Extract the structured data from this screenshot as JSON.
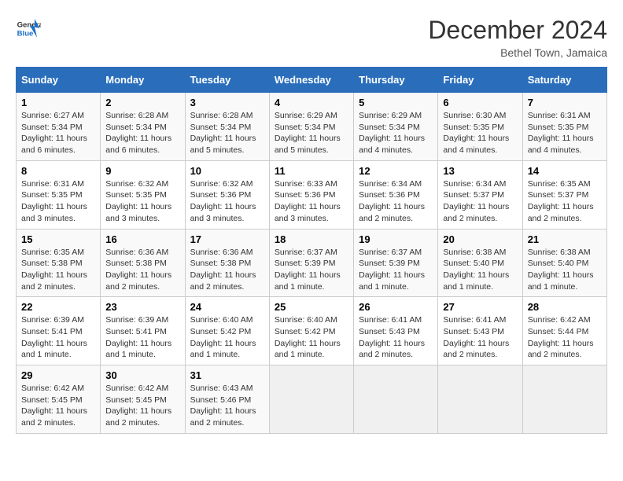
{
  "header": {
    "logo_general": "General",
    "logo_blue": "Blue",
    "month_title": "December 2024",
    "location": "Bethel Town, Jamaica"
  },
  "columns": [
    "Sunday",
    "Monday",
    "Tuesday",
    "Wednesday",
    "Thursday",
    "Friday",
    "Saturday"
  ],
  "weeks": [
    [
      {
        "day": "1",
        "sunrise": "6:27 AM",
        "sunset": "5:34 PM",
        "daylight": "11 hours and 6 minutes."
      },
      {
        "day": "2",
        "sunrise": "6:28 AM",
        "sunset": "5:34 PM",
        "daylight": "11 hours and 6 minutes."
      },
      {
        "day": "3",
        "sunrise": "6:28 AM",
        "sunset": "5:34 PM",
        "daylight": "11 hours and 5 minutes."
      },
      {
        "day": "4",
        "sunrise": "6:29 AM",
        "sunset": "5:34 PM",
        "daylight": "11 hours and 5 minutes."
      },
      {
        "day": "5",
        "sunrise": "6:29 AM",
        "sunset": "5:34 PM",
        "daylight": "11 hours and 4 minutes."
      },
      {
        "day": "6",
        "sunrise": "6:30 AM",
        "sunset": "5:35 PM",
        "daylight": "11 hours and 4 minutes."
      },
      {
        "day": "7",
        "sunrise": "6:31 AM",
        "sunset": "5:35 PM",
        "daylight": "11 hours and 4 minutes."
      }
    ],
    [
      {
        "day": "8",
        "sunrise": "6:31 AM",
        "sunset": "5:35 PM",
        "daylight": "11 hours and 3 minutes."
      },
      {
        "day": "9",
        "sunrise": "6:32 AM",
        "sunset": "5:35 PM",
        "daylight": "11 hours and 3 minutes."
      },
      {
        "day": "10",
        "sunrise": "6:32 AM",
        "sunset": "5:36 PM",
        "daylight": "11 hours and 3 minutes."
      },
      {
        "day": "11",
        "sunrise": "6:33 AM",
        "sunset": "5:36 PM",
        "daylight": "11 hours and 3 minutes."
      },
      {
        "day": "12",
        "sunrise": "6:34 AM",
        "sunset": "5:36 PM",
        "daylight": "11 hours and 2 minutes."
      },
      {
        "day": "13",
        "sunrise": "6:34 AM",
        "sunset": "5:37 PM",
        "daylight": "11 hours and 2 minutes."
      },
      {
        "day": "14",
        "sunrise": "6:35 AM",
        "sunset": "5:37 PM",
        "daylight": "11 hours and 2 minutes."
      }
    ],
    [
      {
        "day": "15",
        "sunrise": "6:35 AM",
        "sunset": "5:38 PM",
        "daylight": "11 hours and 2 minutes."
      },
      {
        "day": "16",
        "sunrise": "6:36 AM",
        "sunset": "5:38 PM",
        "daylight": "11 hours and 2 minutes."
      },
      {
        "day": "17",
        "sunrise": "6:36 AM",
        "sunset": "5:38 PM",
        "daylight": "11 hours and 2 minutes."
      },
      {
        "day": "18",
        "sunrise": "6:37 AM",
        "sunset": "5:39 PM",
        "daylight": "11 hours and 1 minute."
      },
      {
        "day": "19",
        "sunrise": "6:37 AM",
        "sunset": "5:39 PM",
        "daylight": "11 hours and 1 minute."
      },
      {
        "day": "20",
        "sunrise": "6:38 AM",
        "sunset": "5:40 PM",
        "daylight": "11 hours and 1 minute."
      },
      {
        "day": "21",
        "sunrise": "6:38 AM",
        "sunset": "5:40 PM",
        "daylight": "11 hours and 1 minute."
      }
    ],
    [
      {
        "day": "22",
        "sunrise": "6:39 AM",
        "sunset": "5:41 PM",
        "daylight": "11 hours and 1 minute."
      },
      {
        "day": "23",
        "sunrise": "6:39 AM",
        "sunset": "5:41 PM",
        "daylight": "11 hours and 1 minute."
      },
      {
        "day": "24",
        "sunrise": "6:40 AM",
        "sunset": "5:42 PM",
        "daylight": "11 hours and 1 minute."
      },
      {
        "day": "25",
        "sunrise": "6:40 AM",
        "sunset": "5:42 PM",
        "daylight": "11 hours and 1 minute."
      },
      {
        "day": "26",
        "sunrise": "6:41 AM",
        "sunset": "5:43 PM",
        "daylight": "11 hours and 2 minutes."
      },
      {
        "day": "27",
        "sunrise": "6:41 AM",
        "sunset": "5:43 PM",
        "daylight": "11 hours and 2 minutes."
      },
      {
        "day": "28",
        "sunrise": "6:42 AM",
        "sunset": "5:44 PM",
        "daylight": "11 hours and 2 minutes."
      }
    ],
    [
      {
        "day": "29",
        "sunrise": "6:42 AM",
        "sunset": "5:45 PM",
        "daylight": "11 hours and 2 minutes."
      },
      {
        "day": "30",
        "sunrise": "6:42 AM",
        "sunset": "5:45 PM",
        "daylight": "11 hours and 2 minutes."
      },
      {
        "day": "31",
        "sunrise": "6:43 AM",
        "sunset": "5:46 PM",
        "daylight": "11 hours and 2 minutes."
      },
      null,
      null,
      null,
      null
    ]
  ],
  "labels": {
    "sunrise": "Sunrise:",
    "sunset": "Sunset:",
    "daylight": "Daylight:"
  }
}
